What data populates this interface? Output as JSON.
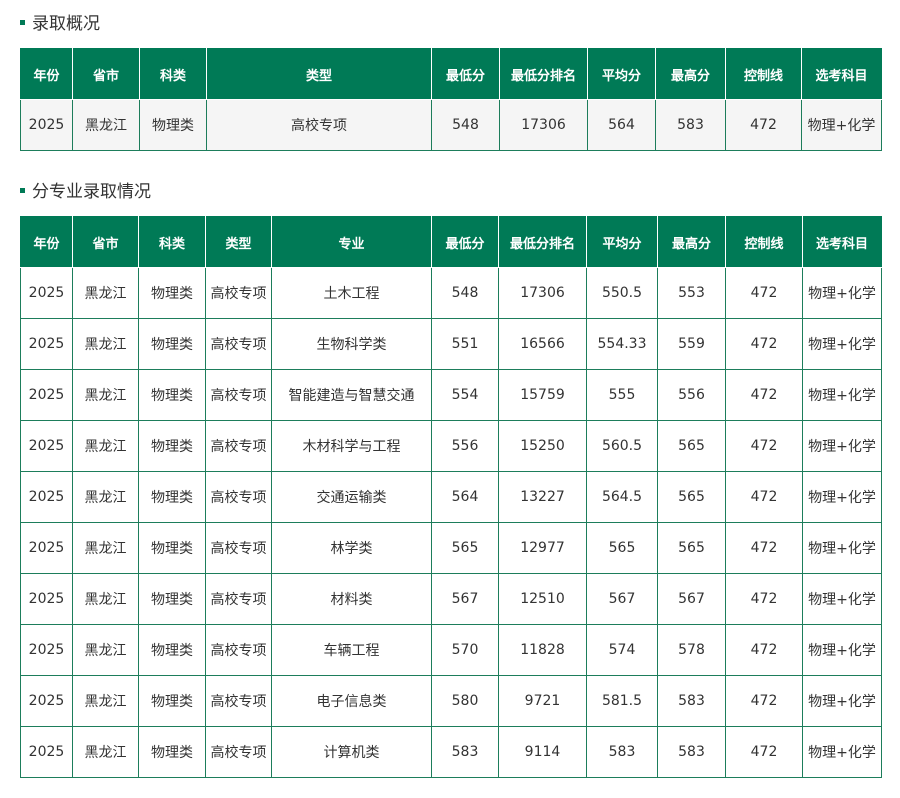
{
  "summary": {
    "title": "录取概况",
    "headers": [
      "年份",
      "省市",
      "科类",
      "类型",
      "最低分",
      "最低分排名",
      "平均分",
      "最高分",
      "控制线",
      "选考科目"
    ],
    "rows": [
      [
        "2025",
        "黑龙江",
        "物理类",
        "高校专项",
        "548",
        "17306",
        "564",
        "583",
        "472",
        "物理+化学"
      ]
    ]
  },
  "majors": {
    "title": "分专业录取情况",
    "headers": [
      "年份",
      "省市",
      "科类",
      "类型",
      "专业",
      "最低分",
      "最低分排名",
      "平均分",
      "最高分",
      "控制线",
      "选考科目"
    ],
    "rows": [
      [
        "2025",
        "黑龙江",
        "物理类",
        "高校专项",
        "土木工程",
        "548",
        "17306",
        "550.5",
        "553",
        "472",
        "物理+化学"
      ],
      [
        "2025",
        "黑龙江",
        "物理类",
        "高校专项",
        "生物科学类",
        "551",
        "16566",
        "554.33",
        "559",
        "472",
        "物理+化学"
      ],
      [
        "2025",
        "黑龙江",
        "物理类",
        "高校专项",
        "智能建造与智慧交通",
        "554",
        "15759",
        "555",
        "556",
        "472",
        "物理+化学"
      ],
      [
        "2025",
        "黑龙江",
        "物理类",
        "高校专项",
        "木材科学与工程",
        "556",
        "15250",
        "560.5",
        "565",
        "472",
        "物理+化学"
      ],
      [
        "2025",
        "黑龙江",
        "物理类",
        "高校专项",
        "交通运输类",
        "564",
        "13227",
        "564.5",
        "565",
        "472",
        "物理+化学"
      ],
      [
        "2025",
        "黑龙江",
        "物理类",
        "高校专项",
        "林学类",
        "565",
        "12977",
        "565",
        "565",
        "472",
        "物理+化学"
      ],
      [
        "2025",
        "黑龙江",
        "物理类",
        "高校专项",
        "材料类",
        "567",
        "12510",
        "567",
        "567",
        "472",
        "物理+化学"
      ],
      [
        "2025",
        "黑龙江",
        "物理类",
        "高校专项",
        "车辆工程",
        "570",
        "11828",
        "574",
        "578",
        "472",
        "物理+化学"
      ],
      [
        "2025",
        "黑龙江",
        "物理类",
        "高校专项",
        "电子信息类",
        "580",
        "9721",
        "581.5",
        "583",
        "472",
        "物理+化学"
      ],
      [
        "2025",
        "黑龙江",
        "物理类",
        "高校专项",
        "计算机类",
        "583",
        "9114",
        "583",
        "583",
        "472",
        "物理+化学"
      ]
    ]
  },
  "colors": {
    "accent": "#007a56",
    "border": "#1d7d5b"
  }
}
